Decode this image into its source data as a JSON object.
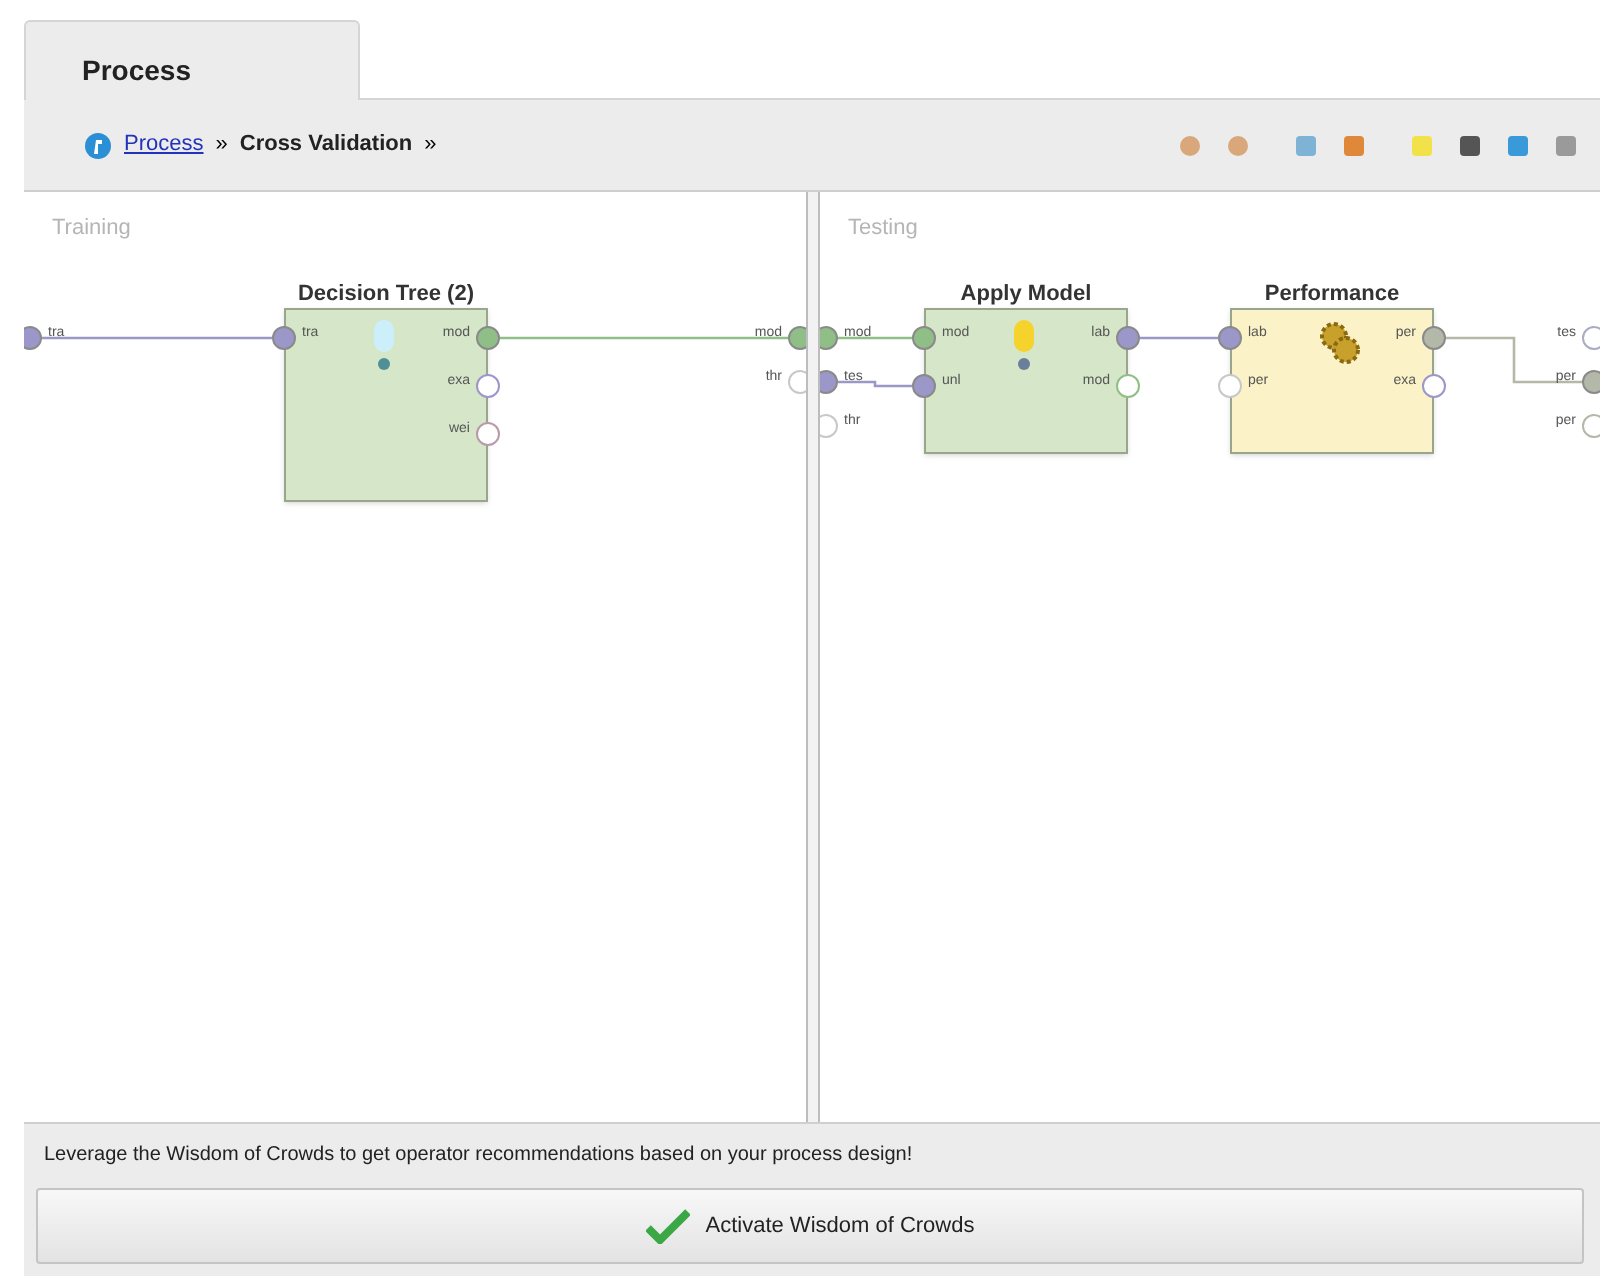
{
  "tabs": [
    {
      "label": "Process",
      "selected": true
    }
  ],
  "breadcrumb": {
    "link": "Process",
    "separator_1": "»",
    "current": "Cross Validation",
    "separator_2": "»"
  },
  "panels": [
    {
      "title": "Training",
      "inputs": [
        {
          "label": "tra",
          "color": "#9b97c9",
          "connected": true
        }
      ],
      "outputs": [
        {
          "label": "mod",
          "color": "#8fbf87",
          "connected": true
        },
        {
          "label": "thr",
          "color": "#c8c8c8",
          "connected": false
        }
      ],
      "nodes": [
        {
          "title": "Decision Tree (2)",
          "kind": "learner",
          "color": "#d6e6c8",
          "inputs": [
            {
              "label": "tra",
              "color": "#9b97c9",
              "connected": true
            }
          ],
          "outputs": [
            {
              "label": "mod",
              "color": "#8fbf87",
              "connected": true
            },
            {
              "label": "exa",
              "color": "#9b97c9",
              "connected": false
            },
            {
              "label": "wei",
              "color": "#b99aa8",
              "connected": false
            }
          ]
        }
      ]
    },
    {
      "title": "Testing",
      "inputs": [
        {
          "label": "mod",
          "color": "#8fbf87",
          "connected": true
        },
        {
          "label": "tes",
          "color": "#9b97c9",
          "connected": true
        },
        {
          "label": "thr",
          "color": "#c8c8c8",
          "connected": false
        }
      ],
      "outputs": [
        {
          "label": "tes",
          "color": "#a9acc4",
          "connected": false
        },
        {
          "label": "per",
          "color": "#b4b8a8",
          "connected": true
        },
        {
          "label": "per",
          "color": "#b4b8a8",
          "connected": false
        }
      ],
      "nodes": [
        {
          "title": "Apply Model",
          "kind": "applier",
          "color": "#d6e6c8",
          "inputs": [
            {
              "label": "mod",
              "color": "#8fbf87",
              "connected": true
            },
            {
              "label": "unl",
              "color": "#9b97c9",
              "connected": true
            }
          ],
          "outputs": [
            {
              "label": "lab",
              "color": "#9b97c9",
              "connected": true
            },
            {
              "label": "mod",
              "color": "#8fbf87",
              "connected": false
            }
          ]
        },
        {
          "title": "Performance",
          "kind": "evaluator",
          "color": "#fbf2c8",
          "inputs": [
            {
              "label": "lab",
              "color": "#9b97c9",
              "connected": true
            },
            {
              "label": "per",
              "color": "#c8c8c8",
              "connected": false
            }
          ],
          "outputs": [
            {
              "label": "per",
              "color": "#b4b8a8",
              "connected": true
            },
            {
              "label": "exa",
              "color": "#9b97c9",
              "connected": false
            }
          ]
        }
      ]
    }
  ],
  "footer": {
    "message": "Leverage the Wisdom of Crowds to get operator recommendations based on your process design!",
    "button": "Activate Wisdom of Crowds"
  }
}
